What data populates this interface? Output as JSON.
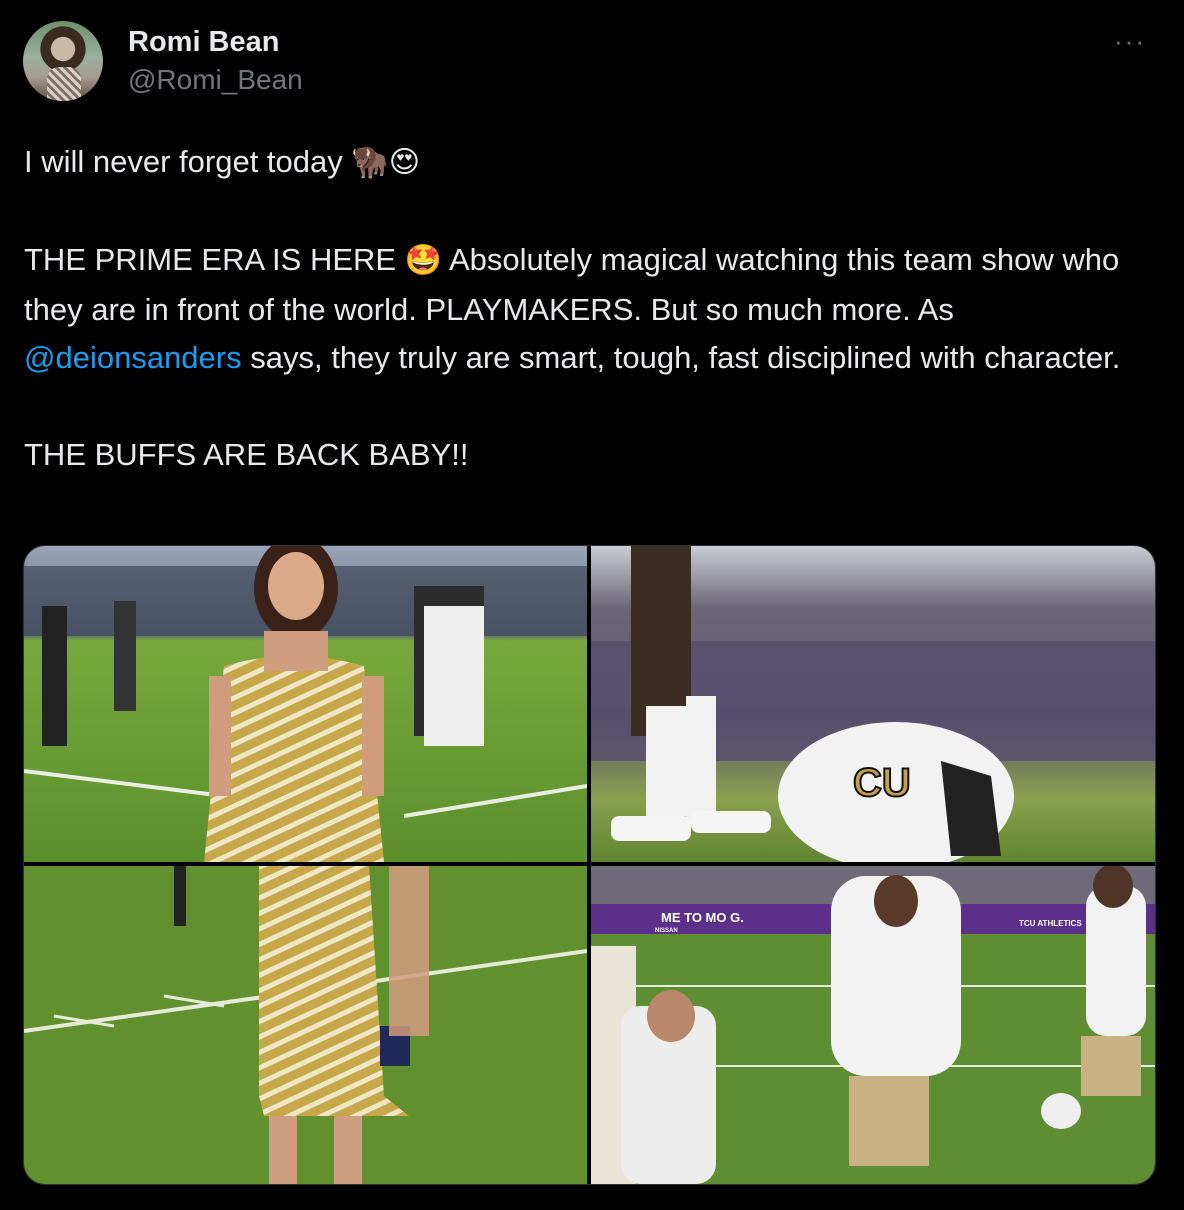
{
  "author": {
    "name": "Romi Bean",
    "handle": "@Romi_Bean",
    "avatar_icon": "profile-avatar"
  },
  "more_menu": {
    "label": "···",
    "icon": "more-options-icon"
  },
  "tweet": {
    "line1": "I will never forget today",
    "line1_emojis": "🦬😍",
    "para2_start": "THE PRIME ERA IS HERE",
    "para2_emoji": "🤩",
    "para2_mid": "Absolutely magical watching this team show who they are in front of the world. PLAYMAKERS. But so much more. As",
    "mention": "@deionsanders",
    "para2_end": "says, they truly are smart, tough, fast disciplined with character.",
    "line3": "THE BUFFS ARE BACK BABY!!"
  },
  "media": {
    "images": [
      {
        "subject": "woman-in-gold-zebra-dress-on-field"
      },
      {
        "subject": "colorado-buffaloes-helmet-on-field"
      },
      {
        "subject": "woman-dress-full-length-on-field"
      },
      {
        "subject": "coach-and-players-warming-up"
      }
    ],
    "banner_text": "ME TO   MO  G.",
    "banner_text2": "TCU ATHLETICS",
    "sponsor_text": "NISSAN"
  },
  "colors": {
    "background": "#000000",
    "text": "#e7e9ea",
    "secondary": "#71767b",
    "link": "#1d9bf0",
    "border": "#2f3336"
  }
}
